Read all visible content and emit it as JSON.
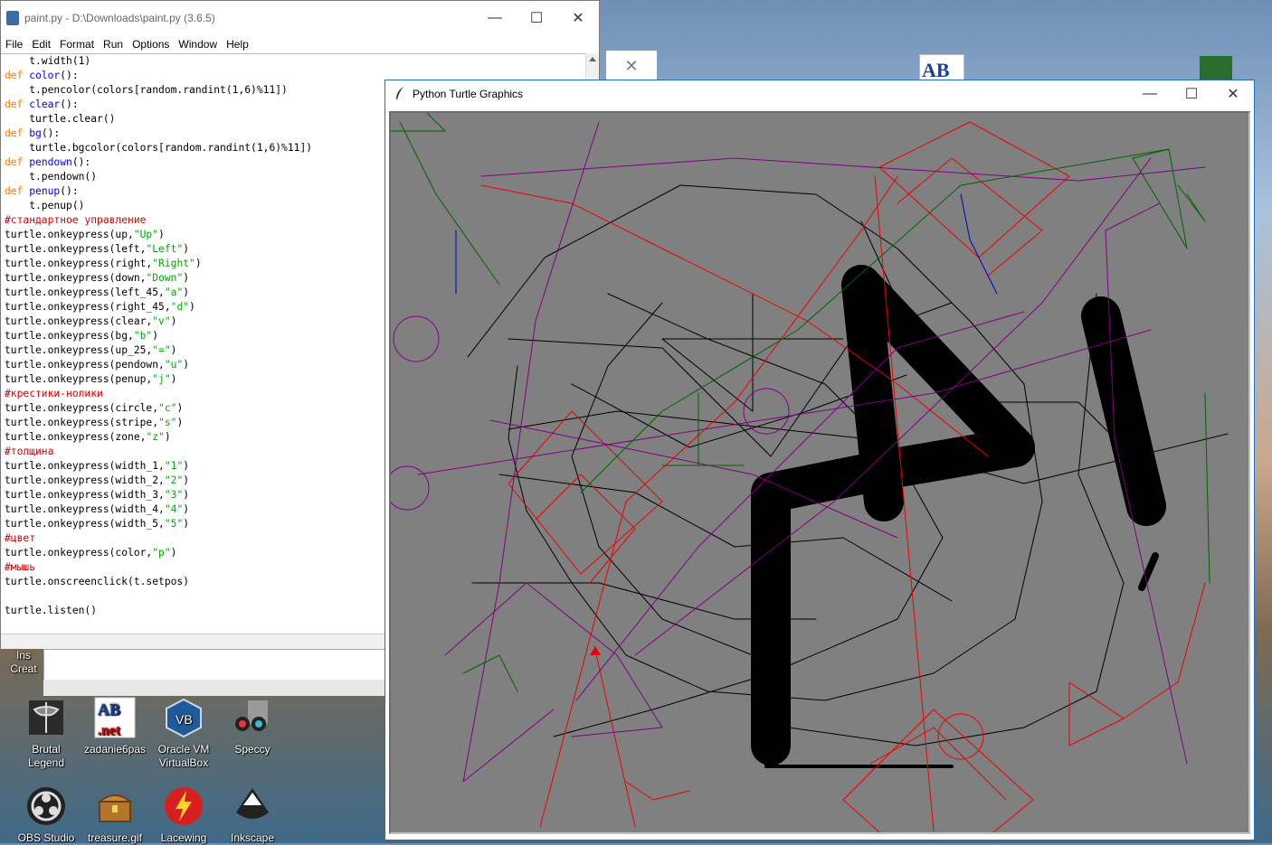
{
  "idle": {
    "title": "paint.py - D:\\Downloads\\paint.py (3.6.5)",
    "menu": [
      "File",
      "Edit",
      "Format",
      "Run",
      "Options",
      "Window",
      "Help"
    ],
    "code_lines": [
      "    t.width(1)",
      "def color():",
      "    t.pencolor(colors[random.randint(1,6)%11])",
      "def clear():",
      "    turtle.clear()",
      "def bg():",
      "    turtle.bgcolor(colors[random.randint(1,6)%11])",
      "def pendown():",
      "    t.pendown()",
      "def penup():",
      "    t.penup()",
      "#стандартное управление",
      "turtle.onkeypress(up,\"Up\")",
      "turtle.onkeypress(left,\"Left\")",
      "turtle.onkeypress(right,\"Right\")",
      "turtle.onkeypress(down,\"Down\")",
      "turtle.onkeypress(left_45,\"a\")",
      "turtle.onkeypress(right_45,\"d\")",
      "turtle.onkeypress(clear,\"v\")",
      "turtle.onkeypress(bg,\"b\")",
      "turtle.onkeypress(up_25,\"=\")",
      "turtle.onkeypress(pendown,\"u\")",
      "turtle.onkeypress(penup,\"j\")",
      "#крестики-нолики",
      "turtle.onkeypress(circle,\"c\")",
      "turtle.onkeypress(stripe,\"s\")",
      "turtle.onkeypress(zone,\"z\")",
      "#толщина",
      "turtle.onkeypress(width_1,\"1\")",
      "turtle.onkeypress(width_2,\"2\")",
      "turtle.onkeypress(width_3,\"3\")",
      "turtle.onkeypress(width_4,\"4\")",
      "turtle.onkeypress(width_5,\"5\")",
      "#цвет",
      "turtle.onkeypress(color,\"p\")",
      "#мышь",
      "turtle.onscreenclick(t.setpos)",
      "",
      "turtle.listen()"
    ]
  },
  "turtle_window": {
    "title": "Python Turtle Graphics"
  },
  "window_controls": {
    "minimize": "—",
    "maximize": "☐",
    "close": "✕"
  },
  "desktop": {
    "icons": [
      {
        "label": "Brutal Legend",
        "icon": "axe-icon"
      },
      {
        "label": "zadanie6pas",
        "icon": "abc-net-icon"
      },
      {
        "label": "Oracle VM VirtualBox",
        "icon": "virtualbox-icon"
      },
      {
        "label": "Speccy",
        "icon": "speccy-icon"
      },
      {
        "label": "OBS Studio",
        "icon": "obs-icon"
      },
      {
        "label": "treasure.gif",
        "icon": "treasure-icon"
      },
      {
        "label": "Lacewing",
        "icon": "lightning-icon"
      },
      {
        "label": "Inkscape",
        "icon": "inkscape-icon"
      }
    ],
    "partial_label": "Ins Creat"
  }
}
